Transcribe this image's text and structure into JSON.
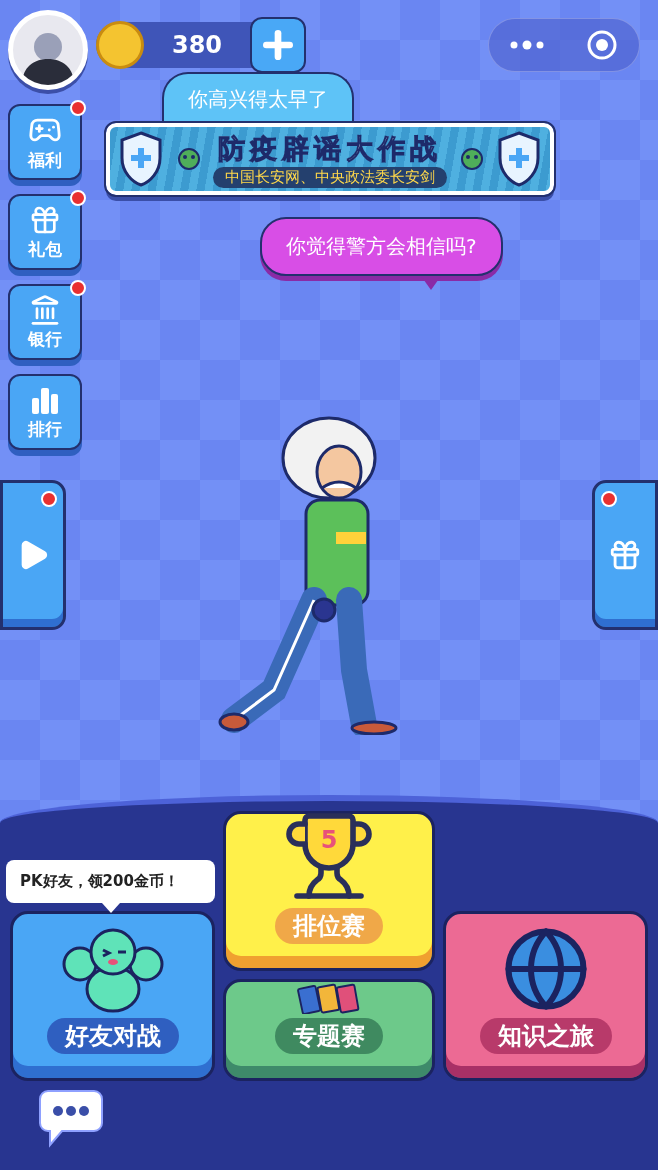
{
  "top_bar": {
    "coins": "380"
  },
  "side_menu": [
    {
      "label": "福利",
      "kind": "gamepad",
      "badge": true
    },
    {
      "label": "礼包",
      "kind": "gift",
      "badge": true
    },
    {
      "label": "银行",
      "kind": "bank",
      "badge": true
    },
    {
      "label": "排行",
      "kind": "chart",
      "badge": false
    }
  ],
  "bubble_top": "你高兴得太早了",
  "banner": {
    "title": "防疫辟谣大作战",
    "subtitle": "中国长安网、中央政法委长安剑"
  },
  "bubble_question": "你觉得警方会相信吗?",
  "side_tabs": [
    {
      "kind": "play",
      "badge": true
    },
    {
      "kind": "gift",
      "badge": true
    }
  ],
  "tooltip": "PK好友，领200金币！",
  "modes": [
    {
      "kind": "ranked",
      "label": "排位赛",
      "rank": "5"
    },
    {
      "kind": "friends",
      "label": "好友对战"
    },
    {
      "kind": "topic",
      "label": "专题赛"
    },
    {
      "kind": "journey",
      "label": "知识之旅"
    }
  ]
}
